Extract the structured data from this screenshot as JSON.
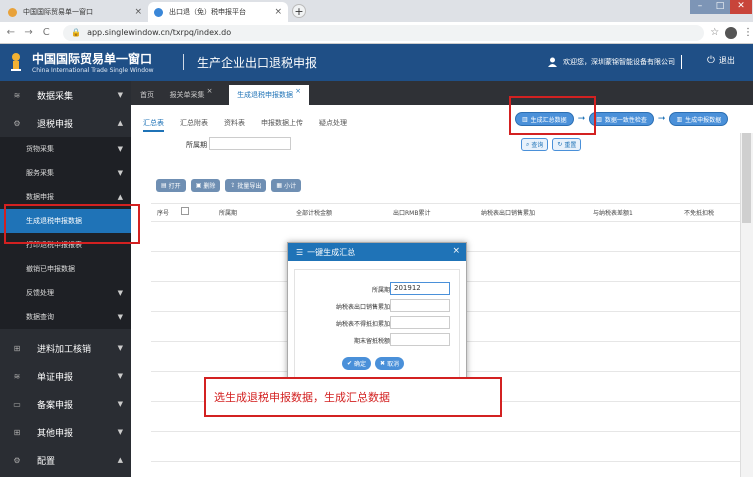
{
  "browser": {
    "tabs": [
      {
        "title": "中国国际贸易单一窗口",
        "close": "×"
      },
      {
        "title": "出口退（免）税申报平台",
        "close": "×"
      }
    ],
    "new_tab": "+",
    "url": "app.singlewindow.cn/txrpq/index.do",
    "back": "←",
    "forward": "→",
    "reload": "C",
    "star": "☆",
    "menu": "⋮"
  },
  "header": {
    "logo_cn": "中国国际贸易单一窗口",
    "logo_en": "China International Trade Single Window",
    "system_title": "生产企业出口退税申报",
    "user_greeting": "欢迎您，深圳蒙锦智能设备有限公司",
    "logout": "退出",
    "bg_color": "#1f4f86"
  },
  "sidebar": {
    "items": [
      {
        "label": "数据采集",
        "icon": "database-icon",
        "arrow": "▼"
      },
      {
        "label": "退税申报",
        "icon": "gear-icon",
        "arrow": "▲"
      },
      {
        "label": "货物采集",
        "arrow": "▼"
      },
      {
        "label": "服务采集",
        "arrow": "▼"
      },
      {
        "label": "数据申报",
        "arrow": "▲"
      },
      {
        "label": "生成退税申报数据"
      },
      {
        "label": "打印退税申报报表"
      },
      {
        "label": "撤销已申报数据"
      },
      {
        "label": "反馈处理",
        "arrow": "▼"
      },
      {
        "label": "数据查询",
        "arrow": "▼"
      },
      {
        "label": "进料加工核销",
        "icon": "grid-icon",
        "arrow": "▼"
      },
      {
        "label": "单证申报",
        "icon": "database-icon",
        "arrow": "▼"
      },
      {
        "label": "备案申报",
        "icon": "book-icon",
        "arrow": "▼"
      },
      {
        "label": "其他申报",
        "icon": "grid-icon",
        "arrow": "▼"
      },
      {
        "label": "配置",
        "icon": "gear-icon",
        "arrow": "▲"
      }
    ],
    "active_color": "#1f73b7"
  },
  "content_tabs": [
    {
      "label": "首页"
    },
    {
      "label": "报关单采集",
      "close": "×"
    },
    {
      "label": "生成退税申报数据",
      "close": "×"
    }
  ],
  "sub_tabs": [
    "汇总表",
    "汇总附表",
    "资料表",
    "申报数据上传",
    "疑点处理"
  ],
  "steps": [
    "生成汇总数据",
    "数据一致性检查",
    "生成申报数据"
  ],
  "filter": {
    "period_label": "所属期",
    "query": "查询",
    "reset": "重置"
  },
  "toolbar": [
    "打开",
    "删除",
    "批量导出",
    "小计"
  ],
  "table": {
    "headers": [
      "序号",
      "所属期",
      "全部计税金额",
      "出口RMB累计",
      "纳税表出口销售累加",
      "与纳税表差额1",
      "不免抵扣税"
    ]
  },
  "modal": {
    "title": "一键生成汇总",
    "close": "×",
    "fields": [
      {
        "label": "所属期",
        "value": "201912"
      },
      {
        "label": "纳税表出口销售累加",
        "value": ""
      },
      {
        "label": "纳税表不得抵扣累加",
        "value": ""
      },
      {
        "label": "期末留抵税额",
        "value": ""
      }
    ],
    "confirm": "确定",
    "cancel": "取消"
  },
  "annotation": {
    "caption": "选生成退税申报数据，生成汇总数据",
    "color": "#d32121"
  }
}
